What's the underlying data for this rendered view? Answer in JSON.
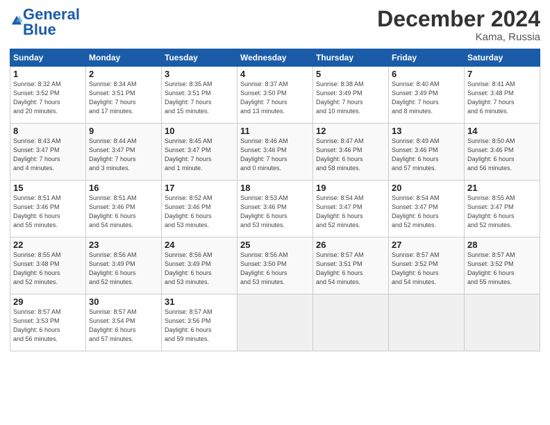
{
  "logo": {
    "part1": "General",
    "part2": "Blue"
  },
  "title": "December 2024",
  "location": "Kama, Russia",
  "days_header": [
    "Sunday",
    "Monday",
    "Tuesday",
    "Wednesday",
    "Thursday",
    "Friday",
    "Saturday"
  ],
  "weeks": [
    [
      {
        "num": "1",
        "info": "Sunrise: 8:32 AM\nSunset: 3:52 PM\nDaylight: 7 hours\nand 20 minutes."
      },
      {
        "num": "2",
        "info": "Sunrise: 8:34 AM\nSunset: 3:51 PM\nDaylight: 7 hours\nand 17 minutes."
      },
      {
        "num": "3",
        "info": "Sunrise: 8:35 AM\nSunset: 3:51 PM\nDaylight: 7 hours\nand 15 minutes."
      },
      {
        "num": "4",
        "info": "Sunrise: 8:37 AM\nSunset: 3:50 PM\nDaylight: 7 hours\nand 13 minutes."
      },
      {
        "num": "5",
        "info": "Sunrise: 8:38 AM\nSunset: 3:49 PM\nDaylight: 7 hours\nand 10 minutes."
      },
      {
        "num": "6",
        "info": "Sunrise: 8:40 AM\nSunset: 3:49 PM\nDaylight: 7 hours\nand 8 minutes."
      },
      {
        "num": "7",
        "info": "Sunrise: 8:41 AM\nSunset: 3:48 PM\nDaylight: 7 hours\nand 6 minutes."
      }
    ],
    [
      {
        "num": "8",
        "info": "Sunrise: 8:43 AM\nSunset: 3:47 PM\nDaylight: 7 hours\nand 4 minutes."
      },
      {
        "num": "9",
        "info": "Sunrise: 8:44 AM\nSunset: 3:47 PM\nDaylight: 7 hours\nand 3 minutes."
      },
      {
        "num": "10",
        "info": "Sunrise: 8:45 AM\nSunset: 3:47 PM\nDaylight: 7 hours\nand 1 minute."
      },
      {
        "num": "11",
        "info": "Sunrise: 8:46 AM\nSunset: 3:46 PM\nDaylight: 7 hours\nand 0 minutes."
      },
      {
        "num": "12",
        "info": "Sunrise: 8:47 AM\nSunset: 3:46 PM\nDaylight: 6 hours\nand 58 minutes."
      },
      {
        "num": "13",
        "info": "Sunrise: 8:49 AM\nSunset: 3:46 PM\nDaylight: 6 hours\nand 57 minutes."
      },
      {
        "num": "14",
        "info": "Sunrise: 8:50 AM\nSunset: 3:46 PM\nDaylight: 6 hours\nand 56 minutes."
      }
    ],
    [
      {
        "num": "15",
        "info": "Sunrise: 8:51 AM\nSunset: 3:46 PM\nDaylight: 6 hours\nand 55 minutes."
      },
      {
        "num": "16",
        "info": "Sunrise: 8:51 AM\nSunset: 3:46 PM\nDaylight: 6 hours\nand 54 minutes."
      },
      {
        "num": "17",
        "info": "Sunrise: 8:52 AM\nSunset: 3:46 PM\nDaylight: 6 hours\nand 53 minutes."
      },
      {
        "num": "18",
        "info": "Sunrise: 8:53 AM\nSunset: 3:46 PM\nDaylight: 6 hours\nand 53 minutes."
      },
      {
        "num": "19",
        "info": "Sunrise: 8:54 AM\nSunset: 3:47 PM\nDaylight: 6 hours\nand 52 minutes."
      },
      {
        "num": "20",
        "info": "Sunrise: 8:54 AM\nSunset: 3:47 PM\nDaylight: 6 hours\nand 52 minutes."
      },
      {
        "num": "21",
        "info": "Sunrise: 8:55 AM\nSunset: 3:47 PM\nDaylight: 6 hours\nand 52 minutes."
      }
    ],
    [
      {
        "num": "22",
        "info": "Sunrise: 8:55 AM\nSunset: 3:48 PM\nDaylight: 6 hours\nand 52 minutes."
      },
      {
        "num": "23",
        "info": "Sunrise: 8:56 AM\nSunset: 3:49 PM\nDaylight: 6 hours\nand 52 minutes."
      },
      {
        "num": "24",
        "info": "Sunrise: 8:56 AM\nSunset: 3:49 PM\nDaylight: 6 hours\nand 53 minutes."
      },
      {
        "num": "25",
        "info": "Sunrise: 8:56 AM\nSunset: 3:50 PM\nDaylight: 6 hours\nand 53 minutes."
      },
      {
        "num": "26",
        "info": "Sunrise: 8:57 AM\nSunset: 3:51 PM\nDaylight: 6 hours\nand 54 minutes."
      },
      {
        "num": "27",
        "info": "Sunrise: 8:57 AM\nSunset: 3:52 PM\nDaylight: 6 hours\nand 54 minutes."
      },
      {
        "num": "28",
        "info": "Sunrise: 8:57 AM\nSunset: 3:52 PM\nDaylight: 6 hours\nand 55 minutes."
      }
    ],
    [
      {
        "num": "29",
        "info": "Sunrise: 8:57 AM\nSunset: 3:53 PM\nDaylight: 6 hours\nand 56 minutes."
      },
      {
        "num": "30",
        "info": "Sunrise: 8:57 AM\nSunset: 3:54 PM\nDaylight: 6 hours\nand 57 minutes."
      },
      {
        "num": "31",
        "info": "Sunrise: 8:57 AM\nSunset: 3:56 PM\nDaylight: 6 hours\nand 59 minutes."
      },
      null,
      null,
      null,
      null
    ]
  ]
}
